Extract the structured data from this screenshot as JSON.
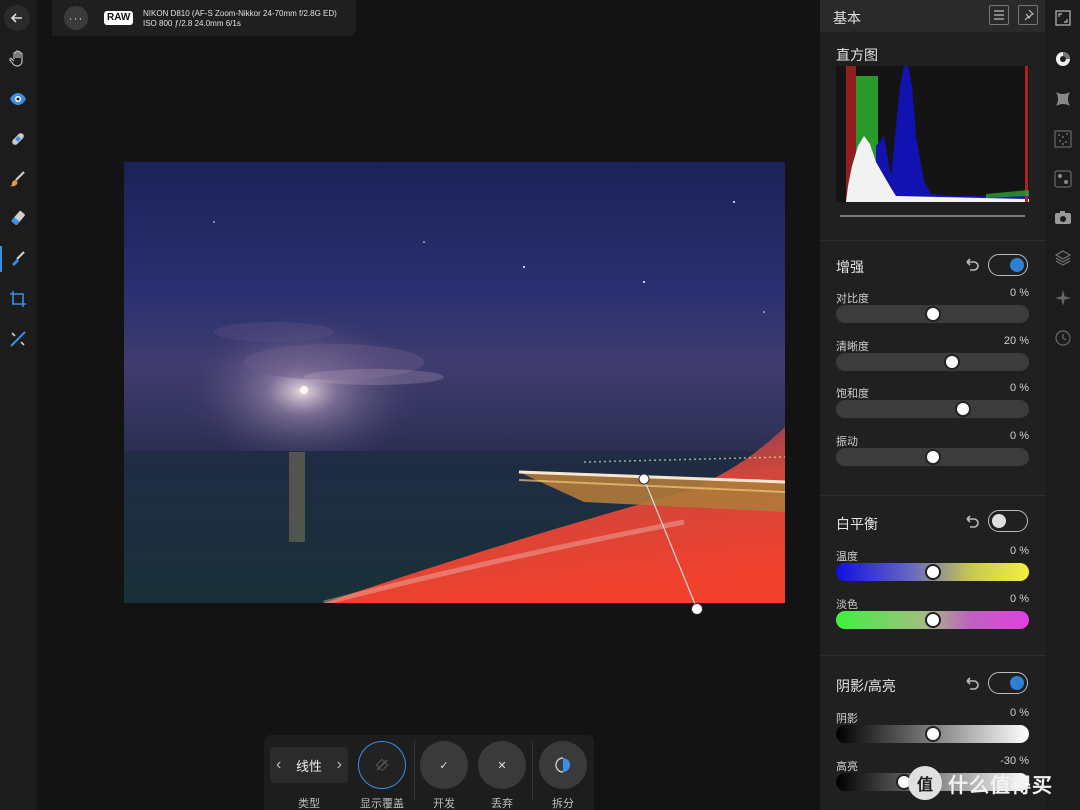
{
  "top_bar": {
    "raw_badge": "RAW",
    "camera_line1": "NIKON D810 (AF-S Zoom-Nikkor 24-70mm f/2.8G ED)",
    "camera_line2": "ISO 800 ƒ/2.8 24.0mm 6/1s",
    "more_label": "···"
  },
  "context_bar": {
    "type_value": "线性",
    "type_label": "类型",
    "show_overlay_label": "显示覆盖",
    "develop_label": "开发",
    "discard_label": "丢弃",
    "split_label": "拆分",
    "develop_glyph": "✓",
    "discard_glyph": "✕"
  },
  "panel": {
    "title": "基本",
    "histogram_title": "直方图",
    "enhance": {
      "title": "增强",
      "enabled": true,
      "sliders": [
        {
          "label": "对比度",
          "value": "0 %",
          "level": 0.5
        },
        {
          "label": "清晰度",
          "value": "20 %",
          "level": 0.6
        },
        {
          "label": "饱和度",
          "value": "0 %",
          "level": 0.66
        },
        {
          "label": "振动",
          "value": "0 %",
          "level": 0.5
        }
      ]
    },
    "white_balance": {
      "title": "白平衡",
      "enabled": false,
      "sliders": [
        {
          "label": "温度",
          "value": "0 %",
          "level": 0.5
        },
        {
          "label": "淡色",
          "value": "0 %",
          "level": 0.5
        }
      ]
    },
    "shadows_highlights": {
      "title": "阴影/高亮",
      "enabled": true,
      "sliders": [
        {
          "label": "阴影",
          "value": "0 %",
          "level": 0.5
        },
        {
          "label": "高亮",
          "value": "-30 %",
          "level": 0.35
        }
      ]
    }
  },
  "watermark": {
    "logo_text": "值",
    "text": "什么值得买"
  },
  "colors": {
    "accent": "#2f7fd4",
    "panel_bg": "#202020",
    "canvas_bg": "#131313"
  }
}
